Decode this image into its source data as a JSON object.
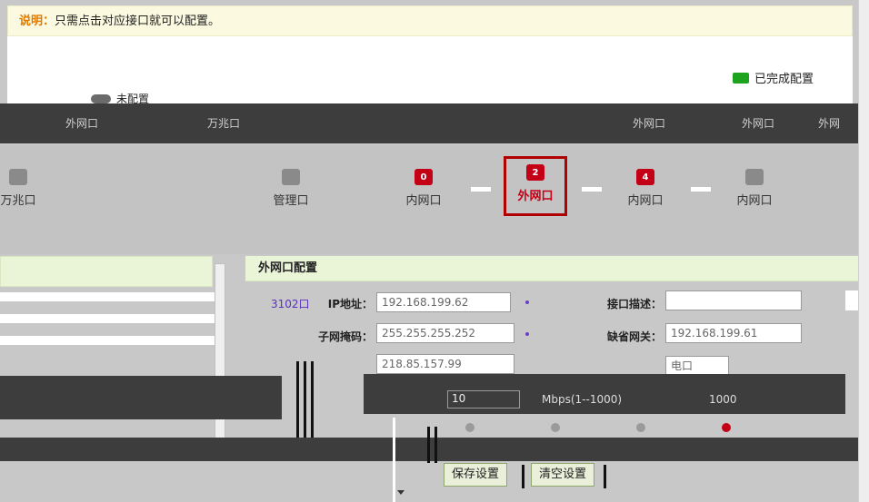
{
  "info": {
    "tag": "说明：",
    "text": "只需点击对应接口就可以配置。"
  },
  "legend": {
    "done": "已完成配置",
    "todo": "未配置"
  },
  "upper_strip": [
    "外网口",
    "万兆口",
    "外网口",
    "外网口",
    "外网"
  ],
  "ports": [
    {
      "num": "",
      "label": "万兆口",
      "style": "gray"
    },
    {
      "num": "",
      "label": "管理口",
      "style": "gray"
    },
    {
      "num": "0",
      "label": "内网口",
      "style": "red"
    },
    {
      "num": "2",
      "label": "外网口",
      "style": "red",
      "selected": true
    },
    {
      "num": "4",
      "label": "内网口",
      "style": "red"
    },
    {
      "num": "",
      "label": "内网口",
      "style": "gray"
    }
  ],
  "config": {
    "title": "外网口配置",
    "prefix": "3102口",
    "ip_label": "IP地址：",
    "ip_value": "192.168.199.62",
    "iface_desc_label": "接口描述：",
    "iface_desc_value": "",
    "mask_label": "子网掩码：",
    "mask_value": "255.255.255.252",
    "gateway_label": "缺省网关：",
    "gateway_value": "192.168.199.61",
    "third_value": "218.85.157.99",
    "select_value": "电口",
    "speed_value": "10",
    "speed_hint": "Mbps(1--1000)",
    "speed_max": "1000"
  },
  "buttons": {
    "save": "保存设置",
    "clear": "清空设置"
  }
}
